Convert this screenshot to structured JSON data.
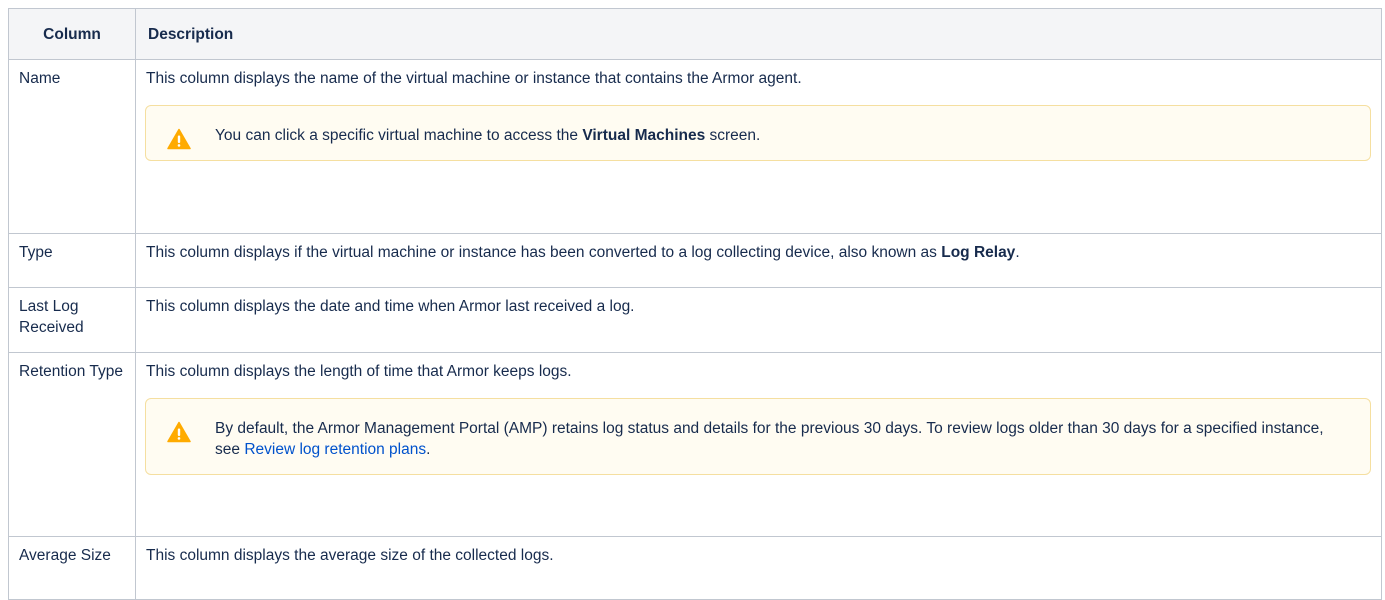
{
  "header": {
    "col1": "Column",
    "col2": "Description"
  },
  "rows": [
    {
      "name": "Name",
      "desc": "This column displays the name of the virtual machine or instance that contains the Armor agent.",
      "note": {
        "pre": "You can click a specific virtual machine to access the ",
        "bold": "Virtual Machines",
        "post": " screen."
      }
    },
    {
      "name": "Type",
      "desc_pre": "This column displays if the virtual machine or instance has been converted to a log collecting device, also known as ",
      "desc_bold": "Log Relay",
      "desc_post": "."
    },
    {
      "name": "Last Log Received",
      "desc": "This column displays the date and time when Armor last received a log."
    },
    {
      "name": "Retention Type",
      "desc": "This column displays the length of time that Armor keeps logs.",
      "note": {
        "pre": "By default, the Armor Management Portal (AMP) retains log status and details for the previous 30 days. To review logs older than 30 days for a specified instance, see ",
        "link": "Review log retention plans",
        "post": "."
      }
    },
    {
      "name": "Average Size",
      "desc": "This column displays the average size of the collected logs."
    }
  ],
  "colors": {
    "header_bg": "#f4f5f7",
    "border": "#c1c7d0",
    "warning_bg": "#fffcf2",
    "warning_border": "#f5dfa0",
    "warning_icon": "#ffab00",
    "link": "#0052cc"
  }
}
